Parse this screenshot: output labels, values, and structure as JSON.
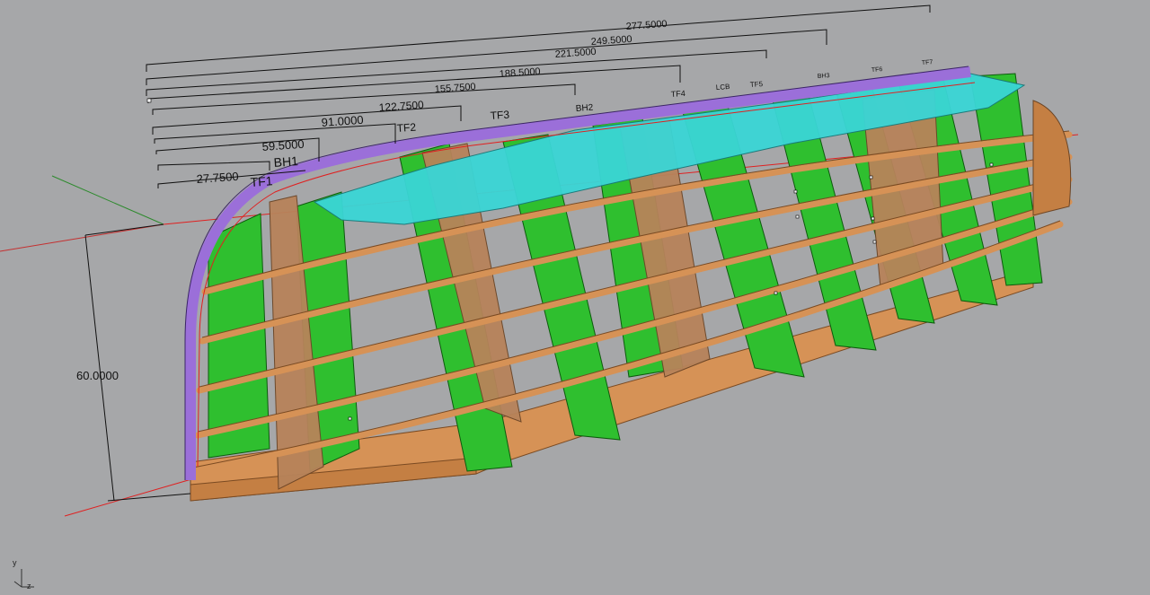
{
  "viewport": {
    "background": "#a6a7a9",
    "colors": {
      "frame_green": "#2fbf2f",
      "plank_orange": "#d08a52",
      "deck_cyan": "#3ad6d6",
      "gunwale_purple": "#9b6fd9",
      "guide_red": "#e02020"
    }
  },
  "dimensions": {
    "stations": [
      "277.5000",
      "249.5000",
      "221.5000",
      "188.5000",
      "155.7500",
      "122.7500",
      "91.0000",
      "59.5000",
      "27.7500"
    ],
    "height": "60.0000"
  },
  "frame_labels": [
    "TF1",
    "BH1",
    "TF2",
    "TF3",
    "BH2",
    "TF4",
    "LCB",
    "TF5",
    "BH3",
    "TF6",
    "TF7"
  ],
  "axis_widget": {
    "y": "y",
    "z": "z"
  }
}
